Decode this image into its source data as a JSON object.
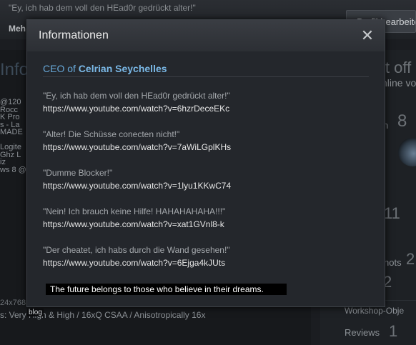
{
  "background": {
    "status_quote": "\"Ey, ich hab dem voll den HEad0r gedrückt alter!\"",
    "nav_label": "Meh",
    "edit_button_label": "Profil bearbeiten",
    "section_title": "Info",
    "offline_label": "it off",
    "online_label": "nline vo",
    "left_lines": [
      "@120",
      "Rocc",
      "K Pro",
      "s - La",
      "MADE",
      "",
      "Logite",
      "Ghz L",
      "iz",
      "ws 8 @"
    ],
    "badge_count": "8",
    "badge_prefix": "n",
    "stat_1": "11",
    "stat_2": "2",
    "stat_3": "2",
    "screenshots_label": "hots",
    "graphics_line": "24x768",
    "graphics_settings": "s: Very High & High / 16xQ CSAA / Anisotropically 16x",
    "blog_label": "blog",
    "workshop_label": "Workshop-Obje",
    "reviews_label": "Reviews",
    "reviews_count": "1"
  },
  "modal": {
    "title": "Informationen",
    "close_glyph": "✕",
    "ceo_prefix": "CEO of ",
    "ceo_name": "Celrian Seychelles",
    "entries": [
      {
        "quote": "\"Ey, ich hab dem voll den HEad0r gedrückt alter!\"",
        "link": "https://www.youtube.com/watch?v=6hzrDeceEKc"
      },
      {
        "quote": "\"Alter! Die Schüsse conecten nicht!\"",
        "link": "https://www.youtube.com/watch?v=7aWiLGplKHs"
      },
      {
        "quote": "\"Dumme Blocker!\"",
        "link": "https://www.youtube.com/watch?v=1lyu1KKwC74"
      },
      {
        "quote": "\"Nein! Ich brauch keine Hilfe! HAHAHAHAHA!!!\"",
        "link": "https://www.youtube.com/watch?v=xat1GVnl8-k"
      },
      {
        "quote": "\"Der cheatet, ich habs durch die Wand gesehen!\"",
        "link": "https://www.youtube.com/watch?v=6Ejga4kJUts"
      }
    ],
    "motto": "The future belongs to those who believe in their dreams."
  }
}
